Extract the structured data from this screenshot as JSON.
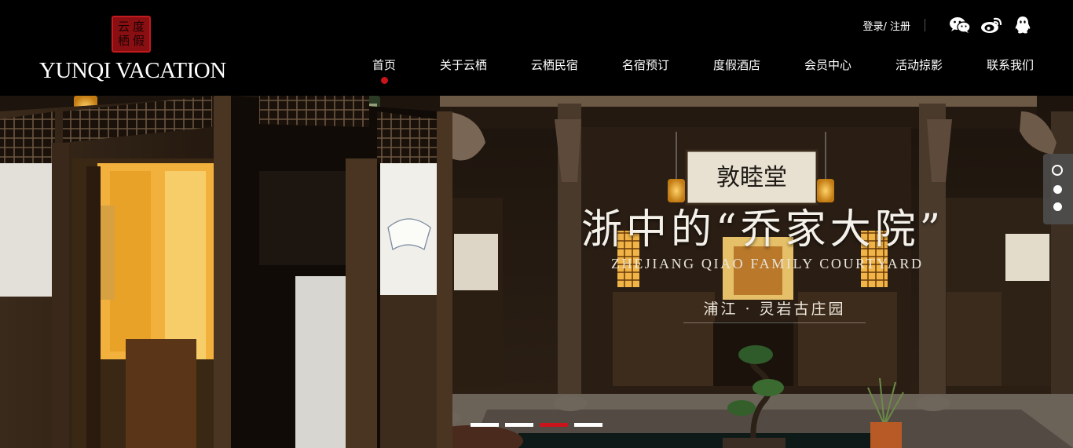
{
  "brand": {
    "seal_chars": [
      "度",
      "云",
      "假",
      "栖"
    ],
    "name": "YUNQI VACATION"
  },
  "topbar": {
    "login_label": "登录/ 注册",
    "icons": [
      "wechat-icon",
      "weibo-icon",
      "qq-icon"
    ]
  },
  "nav": {
    "items": [
      {
        "label": "首页",
        "active": true
      },
      {
        "label": "关于云栖",
        "active": false
      },
      {
        "label": "云栖民宿",
        "active": false
      },
      {
        "label": "名宿预订",
        "active": false
      },
      {
        "label": "度假酒店",
        "active": false
      },
      {
        "label": "会员中心",
        "active": false
      },
      {
        "label": "活动掠影",
        "active": false
      },
      {
        "label": "联系我们",
        "active": false
      }
    ]
  },
  "hero": {
    "title_cn": "浙中的“乔家大院”",
    "title_en": "ZHEJIANG QIAO FAMILY COURTYARD",
    "location": "浦江 · 灵岩古庄园",
    "plaque": "敦睦堂",
    "side_dots": {
      "count": 3,
      "active_index": 0
    },
    "slides": {
      "count": 4,
      "active_index": 2
    }
  },
  "colors": {
    "background": "#000000",
    "accent_red": "#c8141a",
    "wood_dark": "#2a1d12",
    "lamp_glow": "#f2b13c"
  }
}
